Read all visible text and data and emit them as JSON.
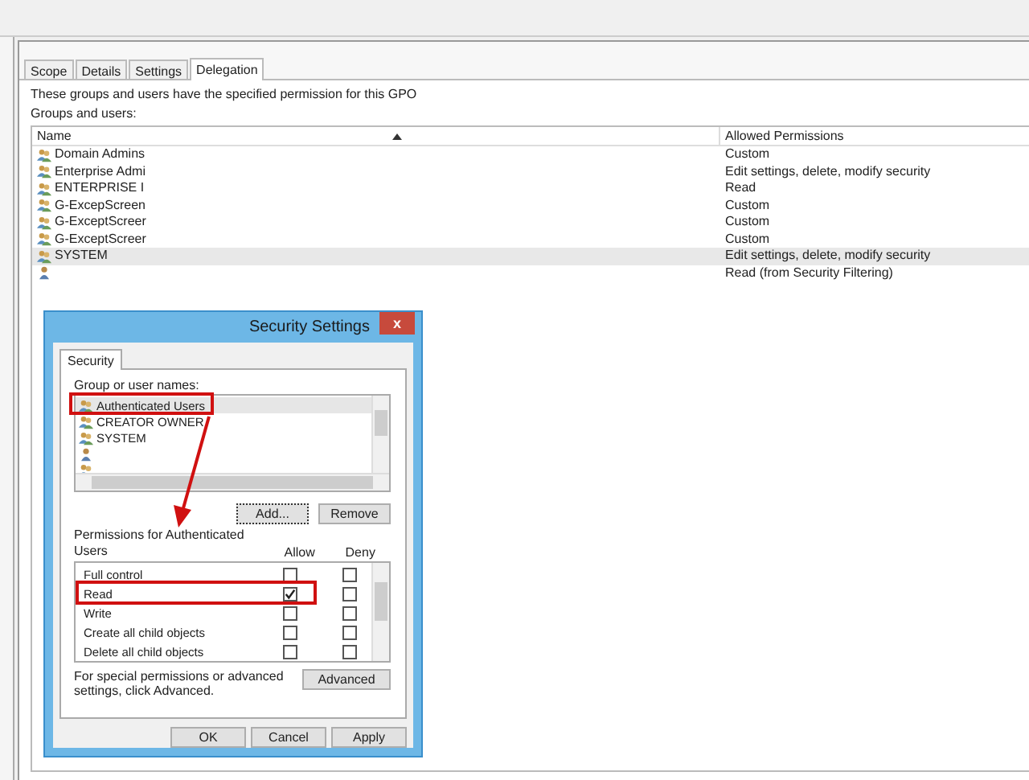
{
  "tabs": [
    {
      "label": "Scope",
      "selected": false
    },
    {
      "label": "Details",
      "selected": false
    },
    {
      "label": "Settings",
      "selected": false
    },
    {
      "label": "Delegation",
      "selected": true
    }
  ],
  "description": "These groups and users have the specified permission for this GPO",
  "list_label": "Groups and users:",
  "table": {
    "columns": [
      "Name",
      "Allowed Permissions"
    ],
    "rows": [
      {
        "kind": "group",
        "name": "Domain Admins",
        "permission": "Custom",
        "selected": false
      },
      {
        "kind": "group",
        "name": "Enterprise Admi",
        "permission": "Edit settings, delete, modify security",
        "selected": false
      },
      {
        "kind": "group",
        "name": "ENTERPRISE I",
        "permission": "Read",
        "selected": false
      },
      {
        "kind": "group",
        "name": "G-ExcepScreen",
        "permission": "Custom",
        "selected": false
      },
      {
        "kind": "group",
        "name": "G-ExceptScreer",
        "permission": "Custom",
        "selected": false
      },
      {
        "kind": "group",
        "name": "G-ExceptScreer",
        "permission": "Custom",
        "selected": false
      },
      {
        "kind": "group",
        "name": "SYSTEM",
        "permission": "Edit settings, delete, modify security",
        "selected": true
      },
      {
        "kind": "user",
        "permission": "Read (from Security Filtering)",
        "selected": false
      }
    ]
  },
  "dialog": {
    "title": "Security Settings",
    "close": "x",
    "tabs": [
      {
        "label": "Security",
        "selected": true
      }
    ],
    "names_label": "Group or user names:",
    "names": [
      {
        "kind": "group",
        "name": "Authenticated Users",
        "selected": true
      },
      {
        "kind": "group",
        "name": "CREATOR OWNER",
        "selected": false
      },
      {
        "kind": "group",
        "name": "SYSTEM",
        "selected": false
      },
      {
        "kind": "user",
        "selected": false
      },
      {
        "kind": "group",
        "selected": false
      }
    ],
    "name_buttons": [
      "Add...",
      "Remove"
    ],
    "permissions_label": "Permissions for Authenticated Users",
    "permission_columns": [
      "Allow",
      "Deny"
    ],
    "permissions": [
      {
        "name": "Full control",
        "allow": false,
        "deny": false
      },
      {
        "name": "Read",
        "allow": true,
        "deny": false
      },
      {
        "name": "Write",
        "allow": false,
        "deny": false
      },
      {
        "name": "Create all child objects",
        "allow": false,
        "deny": false
      },
      {
        "name": "Delete all child objects",
        "allow": false,
        "deny": false
      }
    ],
    "advanced_note": "For special permissions or advanced settings, click Advanced.",
    "advanced_button": "Advanced",
    "buttons": [
      "OK",
      "Cancel",
      "Apply"
    ]
  }
}
